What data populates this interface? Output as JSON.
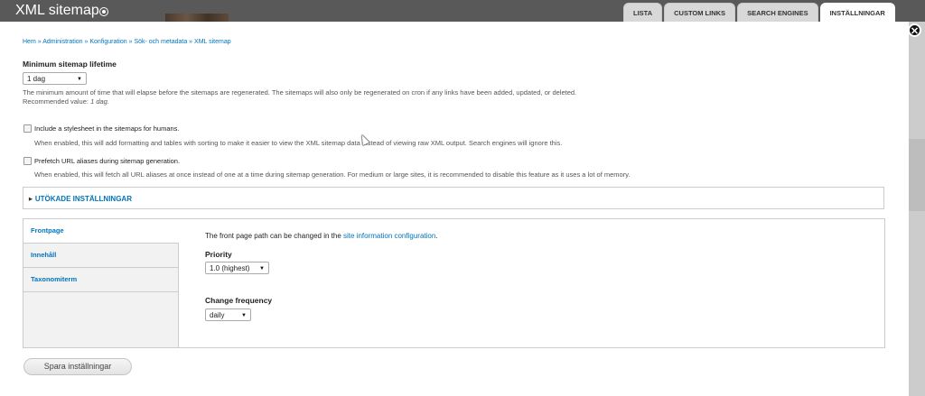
{
  "header": {
    "title": "XML sitemap",
    "tabs": [
      "LISTA",
      "CUSTOM LINKS",
      "SEARCH ENGINES",
      "INSTÄLLNINGAR"
    ],
    "active_tab": "INSTÄLLNINGAR",
    "close_icon": "close-icon"
  },
  "breadcrumb": {
    "items": [
      "Hem",
      "Administration",
      "Konfiguration",
      "Sök- och metadata",
      "XML sitemap"
    ],
    "separator": "»"
  },
  "lifetime": {
    "label": "Minimum sitemap lifetime",
    "value": "1 dag",
    "description": "The minimum amount of time that will elapse before the sitemaps are regenerated. The sitemaps will also only be regenerated on cron if any links have been added, updated, or deleted.",
    "recommended_prefix": "Recommended value:",
    "recommended_value": "1 dag."
  },
  "stylesheet": {
    "label": "Include a stylesheet in the sitemaps for humans.",
    "checked": false,
    "description": "When enabled, this will add formatting and tables with sorting to make it easier to view the XML sitemap data instead of viewing raw XML output. Search engines will ignore this."
  },
  "prefetch": {
    "label": "Prefetch URL aliases during sitemap generation.",
    "checked": false,
    "description": "When enabled, this will fetch all URL aliases at once instead of one at a time during sitemap generation. For medium or large sites, it is recommended to disable this feature as it uses a lot of memory."
  },
  "advanced": {
    "legend": "UTÖKADE INSTÄLLNINGAR"
  },
  "vertical_tabs": {
    "tabs": [
      "Frontpage",
      "Innehåll",
      "Taxonomiterm"
    ],
    "selected": "Frontpage",
    "front_text_prefix": "The front page path can be changed in the",
    "front_link": "site information configuration",
    "front_text_suffix": ".",
    "priority_label": "Priority",
    "priority_value": "1.0 (highest)",
    "changefreq_label": "Change frequency",
    "changefreq_value": "daily"
  },
  "save_button": "Spara inställningar"
}
